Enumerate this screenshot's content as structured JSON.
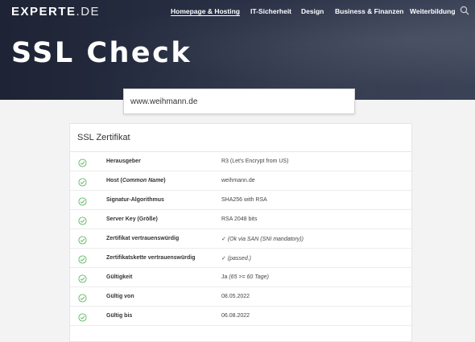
{
  "header": {
    "logo_main": "EXPERTE",
    "logo_tld": ".DE",
    "nav": [
      {
        "label": "Homepage & Hosting",
        "active": true
      },
      {
        "label": "IT-Sicherheit",
        "active": false
      },
      {
        "label": "Design",
        "active": false
      },
      {
        "label": "Business & Finanzen",
        "active": false
      },
      {
        "label": "Weiterbildung",
        "active": false
      }
    ],
    "search_icon": "magnifier-icon",
    "hero_title": "SSL Check"
  },
  "search": {
    "value": "www.weihmann.de",
    "placeholder": ""
  },
  "card": {
    "title": "SSL Zertifikat",
    "rows": [
      {
        "label": "Herausgeber",
        "value": "R3 (Let's Encrypt from US)"
      },
      {
        "label_main": "Host (",
        "label_italic": "Common Name",
        "label_end": ")",
        "value": "weihmann.de"
      },
      {
        "label": "Signatur-Algorithmus",
        "value": "SHA256 with RSA"
      },
      {
        "label": "Server Key (Größe)",
        "value": "RSA 2048 bits"
      },
      {
        "label": "Zertifikat vertrauenswürdig",
        "value_main": "✓ ",
        "value_italic": "(Ok via SAN (SNI mandatory))"
      },
      {
        "label": "Zertifikatskette vertrauenswürdig",
        "value_main": "✓ ",
        "value_italic": "(passed.)"
      },
      {
        "label": "Gültigkeit",
        "value_main": "Ja ",
        "value_italic": "(65 >= 60 Tage)"
      },
      {
        "label": "Gültig von",
        "value": "08.05.2022"
      },
      {
        "label": "Gültig bis",
        "value": "06.08.2022"
      }
    ]
  },
  "colors": {
    "hero_bg": "#262c3e",
    "check_green": "#5cb85c",
    "card_bg": "#ffffff",
    "page_bg": "#f3f3f3"
  },
  "icons": {
    "row_status": "check-circle-icon"
  }
}
